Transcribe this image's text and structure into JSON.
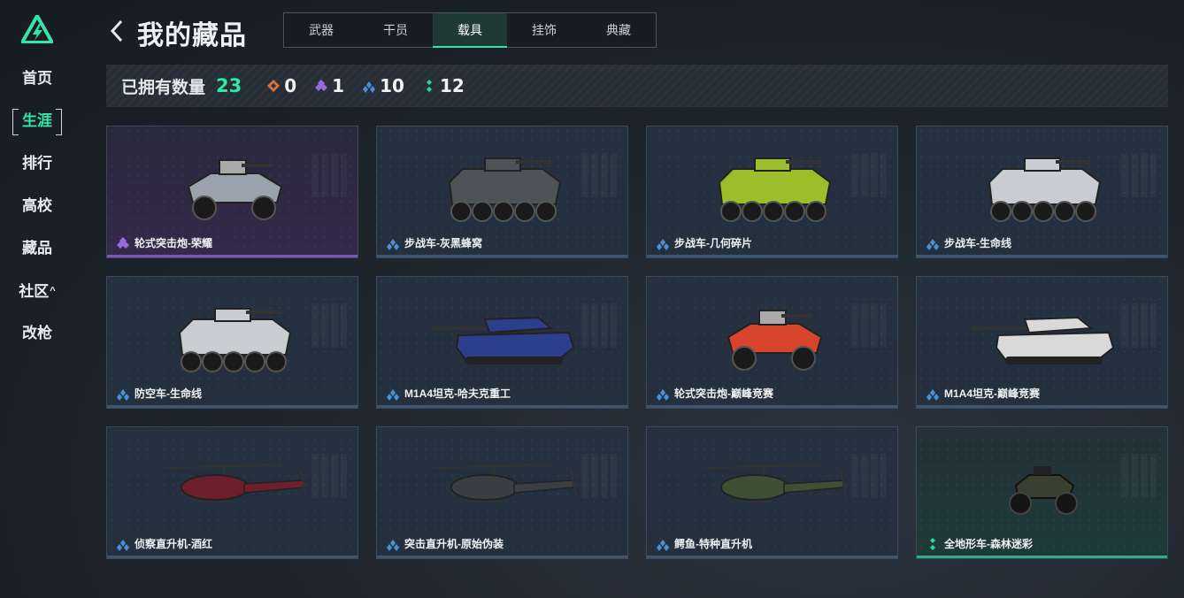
{
  "sidebar": {
    "items": [
      {
        "label": "首页"
      },
      {
        "label": "生涯"
      },
      {
        "label": "排行"
      },
      {
        "label": "高校"
      },
      {
        "label": "藏品"
      },
      {
        "label": "社区"
      },
      {
        "label": "改枪"
      }
    ]
  },
  "header": {
    "title": "我的藏品",
    "tabs": [
      {
        "label": "武器"
      },
      {
        "label": "干员"
      },
      {
        "label": "载具"
      },
      {
        "label": "挂饰"
      },
      {
        "label": "典藏"
      }
    ]
  },
  "stats": {
    "label": "已拥有数量",
    "total": "23",
    "counts": [
      {
        "rarity": "orange",
        "value": "0"
      },
      {
        "rarity": "purple",
        "value": "1"
      },
      {
        "rarity": "blue",
        "value": "10"
      },
      {
        "rarity": "green",
        "value": "12"
      }
    ]
  },
  "colors": {
    "accent": "#35e5a6",
    "orange": "#d7743c",
    "purple": "#9a6be0",
    "blue": "#4a90d9",
    "green": "#2fd69a"
  },
  "items": [
    {
      "name": "轮式突击炮-荣耀",
      "rarity": "purple"
    },
    {
      "name": "步战车-灰黑蜂窝",
      "rarity": "blue"
    },
    {
      "name": "步战车-几何碎片",
      "rarity": "blue"
    },
    {
      "name": "步战车-生命线",
      "rarity": "blue"
    },
    {
      "name": "防空车-生命线",
      "rarity": "blue"
    },
    {
      "name": "M1A4坦克-哈夫克重工",
      "rarity": "blue"
    },
    {
      "name": "轮式突击炮-巅峰竞赛",
      "rarity": "blue"
    },
    {
      "name": "M1A4坦克-巅峰竞赛",
      "rarity": "blue"
    },
    {
      "name": "侦察直升机-酒红",
      "rarity": "blue"
    },
    {
      "name": "突击直升机-原始伪装",
      "rarity": "blue"
    },
    {
      "name": "鳄鱼-特种直升机",
      "rarity": "blue"
    },
    {
      "name": "全地形车-森林迷彩",
      "rarity": "green"
    }
  ]
}
